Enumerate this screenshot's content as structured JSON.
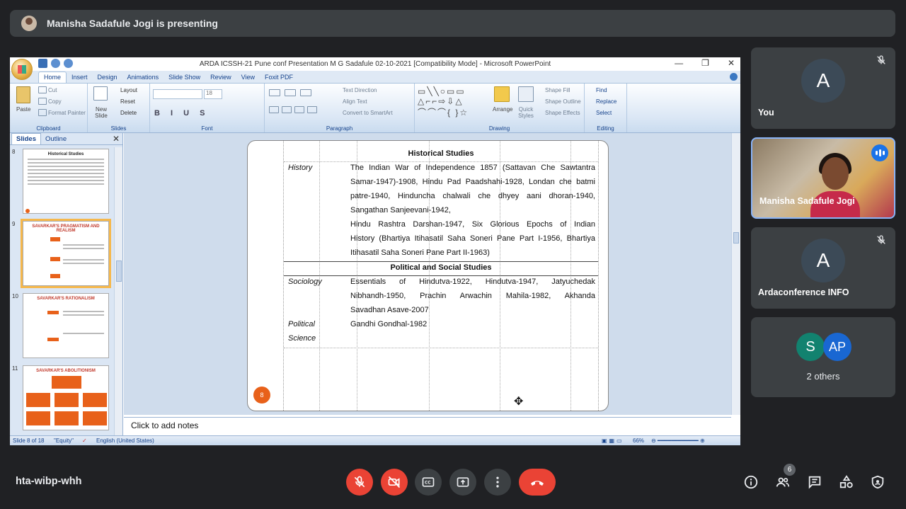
{
  "banner": {
    "text": "Manisha Sadafule Jogi is presenting"
  },
  "ppt": {
    "window_title": "ARDA ICSSH-21 Pune  conf Presentation M G Sadafule 02-10-2021 [Compatibility Mode] - Microsoft PowerPoint",
    "window_buttons": [
      "—",
      "❐",
      "✕"
    ],
    "tabs": [
      "Home",
      "Insert",
      "Design",
      "Animations",
      "Slide Show",
      "Review",
      "View",
      "Foxit PDF"
    ],
    "ribbon": {
      "clipboard": {
        "label": "Clipboard",
        "paste": "Paste",
        "cut": "Cut",
        "copy": "Copy",
        "format_painter": "Format Painter"
      },
      "slides": {
        "label": "Slides",
        "new_slide": "New Slide",
        "layout": "Layout",
        "reset": "Reset",
        "delete": "Delete"
      },
      "font": {
        "label": "Font",
        "size": "18"
      },
      "paragraph": {
        "label": "Paragraph",
        "text_direction": "Text Direction",
        "align_text": "Align Text",
        "smartart": "Convert to SmartArt"
      },
      "drawing": {
        "label": "Drawing",
        "arrange": "Arrange",
        "quick_styles": "Quick Styles",
        "shape_fill": "Shape Fill",
        "shape_outline": "Shape Outline",
        "shape_effects": "Shape Effects"
      },
      "editing": {
        "label": "Editing",
        "find": "Find",
        "replace": "Replace",
        "select": "Select"
      }
    },
    "pane": {
      "tab_slides": "Slides",
      "tab_outline": "Outline",
      "close": "✕"
    },
    "thumbnails": [
      {
        "num": "8",
        "heading": "Historical Studies"
      },
      {
        "num": "9",
        "heading": "SAVARKAR'S PRAGMATISM AND REALISM"
      },
      {
        "num": "10",
        "heading": "SAVARKAR'S RATIONALISM"
      },
      {
        "num": "11",
        "heading": "SAVARKAR'S ABOLITIONISM"
      }
    ],
    "slide": {
      "section1": "Historical Studies",
      "history_label": "History",
      "history_lines": [
        "The Indian War of Independence 1857 (Sattavan Che Sawtantra",
        "Samar-1947)-1908, Hindu Pad Paadshahi-1928, Londan che batmi",
        "patre-1940, Hinduncha chalwali che dhyey aani dhoran-1940,",
        "Sangathan Sanjeevani-1942,",
        "Hindu Rashtra Darshan-1947, Six Glorious Epochs of Indian",
        "History (Bhartiya Itihasatil Saha Soneri Pane Part I-1956, Bhartiya",
        "Itihasatil Saha Soneri Pane Part II-1963)"
      ],
      "section2": "Political and Social Studies",
      "sociology_label": "Sociology",
      "sociology_lines": [
        "Essentials of Hindutva-1922, Hindutva-1947, Jatyuchedak",
        "Nibhandh-1950, Prachin Arwachin Mahila-1982, Akhanda",
        "Savadhan Asave-2007"
      ],
      "political_label_1": "Political",
      "political_label_2": "Science",
      "political_lines": [
        "Gandhi Gondhal-1982"
      ],
      "slide_number": "8"
    },
    "notes_placeholder": "Click to add notes",
    "status": {
      "slide": "Slide 8 of 18",
      "theme": "\"Equity\"",
      "language": "English (United States)",
      "zoom": "66%"
    }
  },
  "participants": {
    "you": {
      "initial": "A",
      "name": "You",
      "color": "#3c4a57"
    },
    "presenter": {
      "name": "Manisha Sadafule Jogi"
    },
    "info": {
      "initial": "A",
      "name": "Ardaconference INFO",
      "color": "#3c4a57"
    },
    "others": {
      "a": "S",
      "b": "AP",
      "label": "2 others",
      "color_a": "#12826f",
      "color_b": "#1967d2"
    }
  },
  "meeting": {
    "code": "hta-wibp-whh",
    "participant_count": "6"
  },
  "colors": {
    "accent_red": "#ea4335",
    "control_gray": "#3c4043",
    "slide_orange": "#e8611a"
  }
}
